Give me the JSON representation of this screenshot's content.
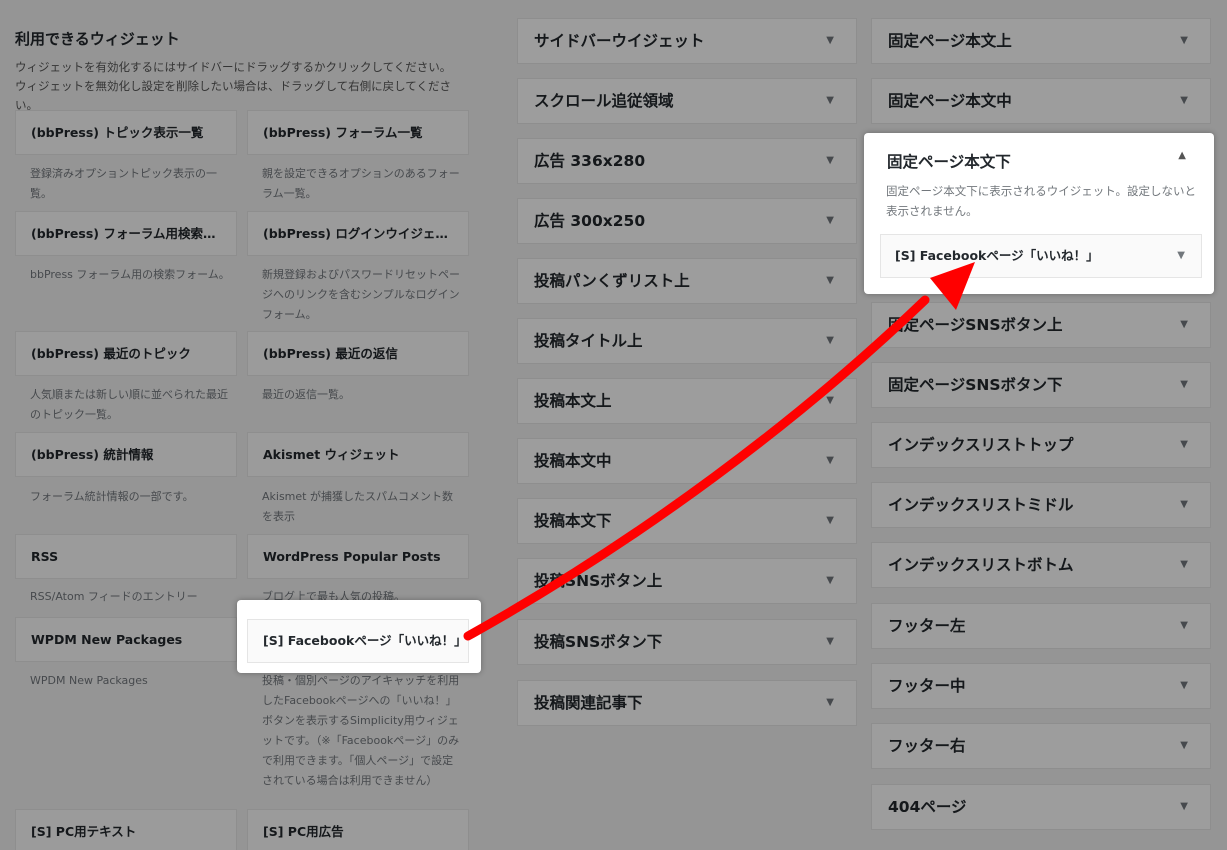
{
  "available": {
    "title": "利用できるウィジェット",
    "description": "ウィジェットを有効化するにはサイドバーにドラッグするかクリックしてください。ウィジェットを無効化し設定を削除したい場合は、ドラッグして右側に戻してください。",
    "widgets_col1": [
      {
        "label": "(bbPress) トピック表示一覧",
        "desc": "登録済みオプショントピック表示の一覧。"
      },
      {
        "label": "(bbPress) フォーラム用検索フ...",
        "desc": "bbPress フォーラム用の検索フォーム。"
      },
      {
        "label": "(bbPress) 最近のトピック",
        "desc": "人気順または新しい順に並べられた最近のトピック一覧。"
      },
      {
        "label": "(bbPress) 統計情報",
        "desc": "フォーラム統計情報の一部です。"
      },
      {
        "label": "RSS",
        "desc": "RSS/Atom フィードのエントリー"
      },
      {
        "label": "WPDM New Packages",
        "desc": "WPDM New Packages"
      },
      {
        "label": "[S] PC用テキスト",
        "desc": ""
      }
    ],
    "widgets_col2": [
      {
        "label": "(bbPress) フォーラム一覧",
        "desc": "親を設定できるオプションのあるフォーラム一覧。"
      },
      {
        "label": "(bbPress) ログインウイジェット",
        "desc": "新規登録およびパスワードリセットページへのリンクを含むシンプルなログインフォーム。"
      },
      {
        "label": "(bbPress) 最近の返信",
        "desc": "最近の返信一覧。"
      },
      {
        "label": "Akismet ウィジェット",
        "desc": "Akismet が捕獲したスパムコメント数を表示"
      },
      {
        "label": "WordPress Popular Posts",
        "desc": "ブログ上で最も人気の投稿。"
      },
      {
        "label": "[S] Facebookページ「いいね！」",
        "desc": "投稿・個別ページのアイキャッチを利用したFacebookページへの「いいね！」ボタンを表示するSimplicity用ウィジェットです。（※「Facebookページ」のみで利用できます。「個人ページ」で設定されている場合は利用できません）"
      },
      {
        "label": "[S] PC用広告",
        "desc": ""
      }
    ]
  },
  "sidebars_mid": [
    "サイドバーウイジェット",
    "スクロール追従領域",
    "広告 336x280",
    "広告 300x250",
    "投稿パンくずリスト上",
    "投稿タイトル上",
    "投稿本文上",
    "投稿本文中",
    "投稿本文下",
    "投稿SNSボタン上",
    "投稿SNSボタン下",
    "投稿関連記事下"
  ],
  "sidebars_right_top": [
    "固定ページ本文上",
    "固定ページ本文中"
  ],
  "open_sidebar": {
    "title": "固定ページ本文下",
    "description": "固定ページ本文下に表示されるウイジェット。設定しないと表示されません。",
    "widget": "[S] Facebookページ「いいね！」"
  },
  "sidebars_right_bottom": [
    "固定ページSNSボタン上",
    "固定ページSNSボタン下",
    "インデックスリストトップ",
    "インデックスリストミドル",
    "インデックスリストボトム",
    "フッター左",
    "フッター中",
    "フッター右",
    "404ページ"
  ],
  "icons": {
    "collapsed": "▼",
    "expanded": "▲"
  },
  "colors": {
    "arrow": "#ff0000"
  }
}
